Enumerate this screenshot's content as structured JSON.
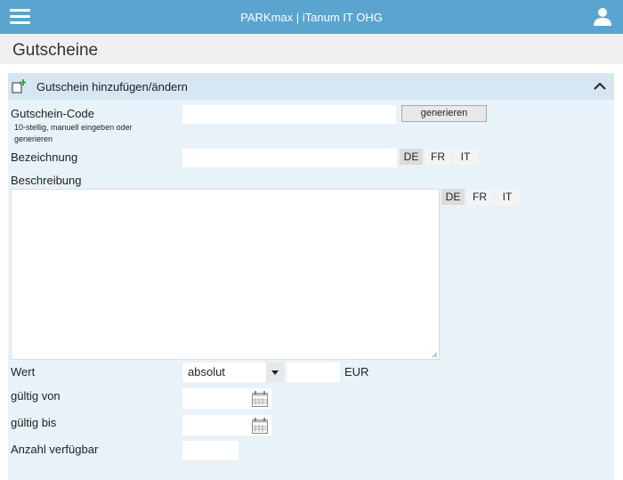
{
  "header": {
    "app_title": "PARKmax | iTanum IT OHG",
    "menu_icon": "hamburger-menu-icon",
    "user_icon": "user-icon",
    "accent_color": "#5ba4cf"
  },
  "page": {
    "title": "Gutscheine"
  },
  "panel": {
    "title": "Gutschein hinzufügen/ändern",
    "icon": "document-add-icon",
    "collapse_icon": "chevron-up-icon"
  },
  "form": {
    "code": {
      "label": "Gutschein-Code",
      "hint": "10-stellig, manuell eingeben oder generieren",
      "value": "",
      "generate_label": "generieren"
    },
    "bezeichnung": {
      "label": "Bezeichnung",
      "value": "",
      "langs": [
        "DE",
        "FR",
        "IT"
      ],
      "active_lang": "DE"
    },
    "beschreibung": {
      "label": "Beschreibung",
      "value": "",
      "langs": [
        "DE",
        "FR",
        "IT"
      ],
      "active_lang": "DE"
    },
    "wert": {
      "label": "Wert",
      "type_selected": "absolut",
      "amount": "",
      "currency": "EUR"
    },
    "gueltig_von": {
      "label": "gültig von",
      "value": "",
      "icon": "calendar-icon"
    },
    "gueltig_bis": {
      "label": "gültig bis",
      "value": "",
      "icon": "calendar-icon"
    },
    "anzahl": {
      "label": "Anzahl verfügbar",
      "value": ""
    }
  }
}
